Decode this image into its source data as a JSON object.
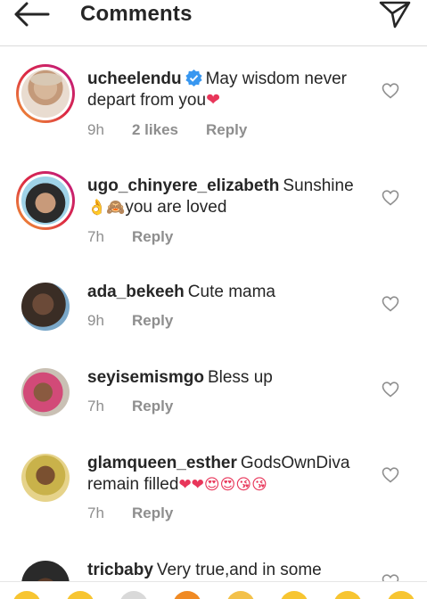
{
  "header": {
    "title": "Comments",
    "back_icon": "arrow-left-icon",
    "send_icon": "paper-plane-icon"
  },
  "comments": [
    {
      "username": "ucheelendu",
      "verified": true,
      "text": "May wisdom never depart from you",
      "emoji": "❤",
      "time": "9h",
      "likes": "2 likes",
      "reply": "Reply"
    },
    {
      "username": "ugo_chinyere_elizabeth",
      "text_pre": "Sunshine",
      "emoji_pre": "👌🙈",
      "text": "you are loved",
      "time": "7h",
      "reply": "Reply"
    },
    {
      "username": "ada_bekeeh",
      "text": "Cute mama",
      "time": "9h",
      "reply": "Reply"
    },
    {
      "username": "seyisemismgo",
      "text": "Bless up",
      "time": "7h",
      "reply": "Reply"
    },
    {
      "username": "glamqueen_esther",
      "text": "GodsOwnDiva remain filled",
      "emoji": "❤❤😍😍😘😘",
      "time": "7h",
      "reply": "Reply"
    },
    {
      "username": "tricbaby",
      "text": "Very true,and in some"
    }
  ],
  "colors": {
    "story_ring": "#dc2743",
    "verified": "#3897f0",
    "meta": "#8e8e8e",
    "heart": "#e8365a"
  }
}
